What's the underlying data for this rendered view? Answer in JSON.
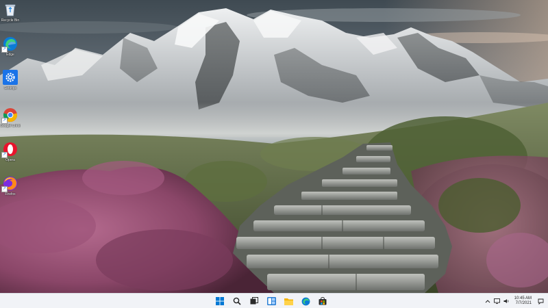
{
  "desktop": {
    "wallpaper_icon": "mountain-landscape-wallpaper",
    "icons": [
      {
        "name": "recycle-bin-icon",
        "label": "Recycle Bin"
      },
      {
        "name": "edge-icon",
        "label": "Edge"
      },
      {
        "name": "settings-icon",
        "label": "Settings"
      },
      {
        "name": "chrome-icon",
        "label": "Google Chrome"
      },
      {
        "name": "opera-icon",
        "label": "Opera"
      },
      {
        "name": "firefox-icon",
        "label": "Firefox"
      }
    ]
  },
  "taskbar": {
    "apps": [
      {
        "name": "start-icon",
        "label": "Start"
      },
      {
        "name": "search-icon",
        "label": "Search"
      },
      {
        "name": "task-view-icon",
        "label": "Task View"
      },
      {
        "name": "widgets-icon",
        "label": "Widgets"
      },
      {
        "name": "file-explorer-icon",
        "label": "File Explorer"
      },
      {
        "name": "edge-icon",
        "label": "Microsoft Edge"
      },
      {
        "name": "store-icon",
        "label": "Microsoft Store"
      }
    ],
    "tray": {
      "overflow_icon": "chevron-up-icon",
      "network_icon": "monitor-icon",
      "volume_icon": "speaker-icon",
      "time": "10:45 AM",
      "date": "7/7/2021",
      "notification_icon": "chat-bubble-icon"
    },
    "colors": {
      "background": "#f1f3f7",
      "windows_blue": "#0078d4"
    }
  }
}
